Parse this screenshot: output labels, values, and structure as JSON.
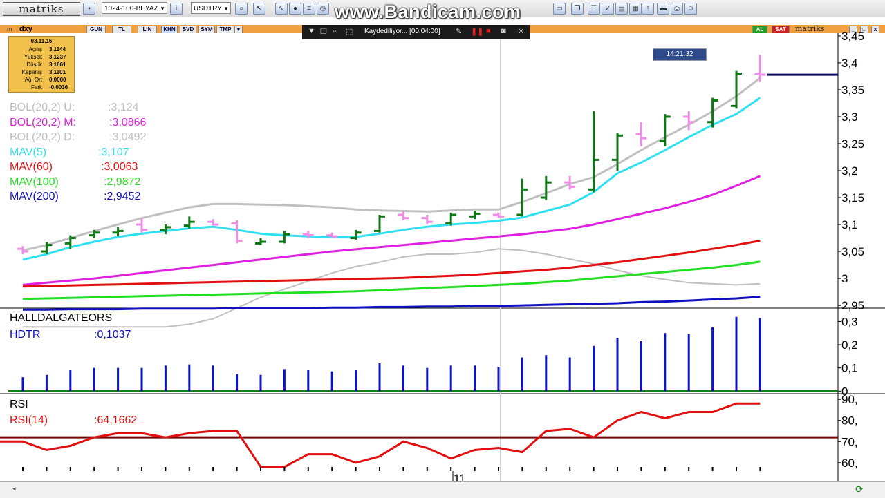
{
  "toolbar": {
    "logo": "matriks",
    "layout_combo": "1024-100-BEYAZ",
    "currency_combo": "USDTRY",
    "watermark": "www.Bandicam.com"
  },
  "subbar": {
    "symbol": "dxy",
    "periods": [
      "GUN",
      "TL",
      "LIN",
      "KHN",
      "SVD",
      "SYM",
      "TMP"
    ],
    "right_tags": [
      "AL",
      "SAT"
    ],
    "right_logo": "matriks"
  },
  "recorder": {
    "status": "Kaydediliyor... [00:04:00]"
  },
  "infobox": {
    "date": "03.11.16",
    "rows": [
      {
        "label": "Açılış",
        "value": "3,1144"
      },
      {
        "label": "Yüksek",
        "value": "3,1237"
      },
      {
        "label": "Düşük",
        "value": "3,1061"
      },
      {
        "label": "Kapanış",
        "value": "3,1101"
      },
      {
        "label": "Ağ. Ort",
        "value": "0,0000"
      },
      {
        "label": "Fark",
        "value": "-0,0036"
      }
    ]
  },
  "crosshair_time": "14:21:32",
  "x_axis_label": "11",
  "colors": {
    "bg": "#ffffff",
    "bar_up": "#0c7a12",
    "bar_down": "#f08ce8",
    "boll_band": "#c0c0c0",
    "boll_mid": "#e020e0",
    "mav5": "#30e0f0",
    "mav60": "#e01010",
    "mav100": "#20e020",
    "mav200": "#1010c0",
    "hdtr": "#0a14c8",
    "rsi": "#e01010",
    "rsi_level": "#800000",
    "last_price_line": "#0a0a60",
    "zero_line": "#108010"
  },
  "chart_data": [
    {
      "type": "ohlc",
      "title": "dxy",
      "legend": [
        {
          "name": "BOL(20,2) U:",
          "value": ":3,124",
          "color": "#c0c0c0"
        },
        {
          "name": "BOL(20,2) M:",
          "value": ":3,0866",
          "color": "#e020e0"
        },
        {
          "name": "BOL(20,2) D:",
          "value": ":3,0492",
          "color": "#c0c0c0"
        },
        {
          "name": "MAV(5)",
          "value": ":3,107",
          "color": "#30e0f0"
        },
        {
          "name": "MAV(60)",
          "value": ":3,0063",
          "color": "#e01010"
        },
        {
          "name": "MAV(100)",
          "value": ":2,9872",
          "color": "#20e020"
        },
        {
          "name": "MAV(200)",
          "value": ":2,9452",
          "color": "#1010c0"
        }
      ],
      "y_ticks": [
        "3,45",
        "3,4",
        "3,35",
        "3,3",
        "3,25",
        "3,2",
        "3,15",
        "3,1",
        "3,05",
        "3",
        "2,95"
      ],
      "ylim": [
        2.945,
        3.455
      ],
      "bars": [
        {
          "o": 3.055,
          "h": 3.06,
          "l": 3.045,
          "c": 3.05,
          "up": false
        },
        {
          "o": 3.05,
          "h": 3.068,
          "l": 3.045,
          "c": 3.062,
          "up": true
        },
        {
          "o": 3.065,
          "h": 3.08,
          "l": 3.055,
          "c": 3.075,
          "up": true
        },
        {
          "o": 3.08,
          "h": 3.09,
          "l": 3.075,
          "c": 3.085,
          "up": true
        },
        {
          "o": 3.085,
          "h": 3.095,
          "l": 3.078,
          "c": 3.088,
          "up": true
        },
        {
          "o": 3.1,
          "h": 3.112,
          "l": 3.085,
          "c": 3.09,
          "up": false
        },
        {
          "o": 3.09,
          "h": 3.1,
          "l": 3.082,
          "c": 3.095,
          "up": true
        },
        {
          "o": 3.098,
          "h": 3.115,
          "l": 3.092,
          "c": 3.105,
          "up": true
        },
        {
          "o": 3.105,
          "h": 3.11,
          "l": 3.098,
          "c": 3.1,
          "up": false
        },
        {
          "o": 3.102,
          "h": 3.108,
          "l": 3.065,
          "c": 3.07,
          "up": false
        },
        {
          "o": 3.065,
          "h": 3.075,
          "l": 3.062,
          "c": 3.068,
          "up": true
        },
        {
          "o": 3.068,
          "h": 3.088,
          "l": 3.065,
          "c": 3.082,
          "up": true
        },
        {
          "o": 3.082,
          "h": 3.088,
          "l": 3.075,
          "c": 3.08,
          "up": false
        },
        {
          "o": 3.08,
          "h": 3.085,
          "l": 3.075,
          "c": 3.078,
          "up": false
        },
        {
          "o": 3.075,
          "h": 3.09,
          "l": 3.072,
          "c": 3.085,
          "up": true
        },
        {
          "o": 3.088,
          "h": 3.118,
          "l": 3.085,
          "c": 3.115,
          "up": true
        },
        {
          "o": 3.118,
          "h": 3.125,
          "l": 3.108,
          "c": 3.112,
          "up": false
        },
        {
          "o": 3.112,
          "h": 3.118,
          "l": 3.1,
          "c": 3.105,
          "up": false
        },
        {
          "o": 3.102,
          "h": 3.122,
          "l": 3.098,
          "c": 3.118,
          "up": true
        },
        {
          "o": 3.115,
          "h": 3.125,
          "l": 3.11,
          "c": 3.12,
          "up": true
        },
        {
          "o": 3.118,
          "h": 3.122,
          "l": 3.112,
          "c": 3.115,
          "up": false
        },
        {
          "o": 3.118,
          "h": 3.185,
          "l": 3.115,
          "c": 3.165,
          "up": true
        },
        {
          "o": 3.15,
          "h": 3.19,
          "l": 3.145,
          "c": 3.178,
          "up": true
        },
        {
          "o": 3.178,
          "h": 3.19,
          "l": 3.165,
          "c": 3.17,
          "up": false
        },
        {
          "o": 3.165,
          "h": 3.31,
          "l": 3.16,
          "c": 3.22,
          "up": true
        },
        {
          "o": 3.22,
          "h": 3.27,
          "l": 3.2,
          "c": 3.265,
          "up": true
        },
        {
          "o": 3.268,
          "h": 3.29,
          "l": 3.245,
          "c": 3.26,
          "up": false
        },
        {
          "o": 3.255,
          "h": 3.305,
          "l": 3.245,
          "c": 3.3,
          "up": true
        },
        {
          "o": 3.3,
          "h": 3.31,
          "l": 3.275,
          "c": 3.29,
          "up": false
        },
        {
          "o": 3.29,
          "h": 3.335,
          "l": 3.28,
          "c": 3.33,
          "up": true
        },
        {
          "o": 3.32,
          "h": 3.385,
          "l": 3.315,
          "c": 3.38,
          "up": true
        },
        {
          "o": 3.38,
          "h": 3.415,
          "l": 3.365,
          "c": 3.378,
          "up": false
        }
      ],
      "last_price": 3.378,
      "series": [
        {
          "name": "BOL(20,2) U",
          "values": [
            3.052,
            3.062,
            3.075,
            3.088,
            3.1,
            3.112,
            3.122,
            3.132,
            3.138,
            3.138,
            3.137,
            3.136,
            3.134,
            3.132,
            3.128,
            3.126,
            3.125,
            3.124,
            3.126,
            3.128,
            3.128,
            3.142,
            3.158,
            3.175,
            3.188,
            3.212,
            3.238,
            3.262,
            3.285,
            3.31,
            3.338,
            3.372
          ]
        },
        {
          "name": "BOL(20,2) M",
          "values": [
            2.988,
            2.992,
            2.996,
            3.0,
            3.005,
            3.01,
            3.015,
            3.02,
            3.025,
            3.03,
            3.035,
            3.04,
            3.045,
            3.05,
            3.054,
            3.058,
            3.062,
            3.066,
            3.07,
            3.074,
            3.078,
            3.082,
            3.087,
            3.092,
            3.1,
            3.11,
            3.12,
            3.13,
            3.142,
            3.155,
            3.172,
            3.19
          ]
        },
        {
          "name": "BOL(20,2) D",
          "values": [
            2.91,
            2.91,
            2.91,
            2.91,
            2.91,
            2.91,
            2.91,
            2.915,
            2.925,
            2.945,
            2.965,
            2.98,
            2.995,
            3.01,
            3.022,
            3.03,
            3.04,
            3.045,
            3.045,
            3.048,
            3.055,
            3.052,
            3.045,
            3.036,
            3.027,
            3.015,
            3.005,
            2.998,
            2.992,
            2.99,
            2.988,
            2.99
          ]
        },
        {
          "name": "MAV(5)",
          "values": [
            3.035,
            3.045,
            3.058,
            3.068,
            3.077,
            3.083,
            3.088,
            3.093,
            3.096,
            3.09,
            3.083,
            3.08,
            3.078,
            3.077,
            3.077,
            3.083,
            3.09,
            3.096,
            3.1,
            3.103,
            3.107,
            3.113,
            3.125,
            3.137,
            3.16,
            3.195,
            3.215,
            3.238,
            3.262,
            3.285,
            3.305,
            3.335
          ]
        },
        {
          "name": "MAV(60)",
          "values": [
            2.985,
            2.986,
            2.987,
            2.988,
            2.989,
            2.99,
            2.991,
            2.992,
            2.993,
            2.994,
            2.995,
            2.996,
            2.997,
            2.998,
            2.999,
            3.0,
            3.001,
            3.003,
            3.005,
            3.007,
            3.01,
            3.013,
            3.016,
            3.02,
            3.025,
            3.03,
            3.036,
            3.042,
            3.048,
            3.055,
            3.062,
            3.07
          ]
        },
        {
          "name": "MAV(100)",
          "values": [
            2.962,
            2.963,
            2.964,
            2.965,
            2.966,
            2.967,
            2.968,
            2.969,
            2.97,
            2.971,
            2.972,
            2.973,
            2.974,
            2.975,
            2.976,
            2.978,
            2.98,
            2.982,
            2.984,
            2.986,
            2.988,
            2.99,
            2.993,
            2.996,
            3.0,
            3.004,
            3.008,
            3.012,
            3.016,
            3.02,
            3.025,
            3.031
          ]
        },
        {
          "name": "MAV(200)",
          "values": [
            2.942,
            2.942,
            2.943,
            2.943,
            2.943,
            2.944,
            2.944,
            2.944,
            2.944,
            2.945,
            2.945,
            2.945,
            2.945,
            2.946,
            2.946,
            2.947,
            2.947,
            2.948,
            2.948,
            2.949,
            2.949,
            2.95,
            2.951,
            2.952,
            2.953,
            2.954,
            2.956,
            2.957,
            2.959,
            2.961,
            2.963,
            2.966
          ]
        }
      ]
    },
    {
      "type": "bar",
      "title": "HALLDALGATEORS",
      "legend": [
        {
          "name": "HDTR",
          "value": ":0,1037",
          "color": "#0a14c8"
        }
      ],
      "y_ticks": [
        "0,3",
        "0,2",
        "0,1",
        "0"
      ],
      "ylim": [
        -0.005,
        0.34
      ],
      "values": [
        0.06,
        0.07,
        0.09,
        0.1,
        0.1,
        0.1,
        0.11,
        0.115,
        0.11,
        0.075,
        0.07,
        0.095,
        0.09,
        0.085,
        0.09,
        0.12,
        0.11,
        0.1,
        0.11,
        0.11,
        0.105,
        0.145,
        0.155,
        0.145,
        0.195,
        0.23,
        0.215,
        0.25,
        0.245,
        0.275,
        0.32,
        0.315
      ]
    },
    {
      "type": "line",
      "title": "RSI",
      "legend": [
        {
          "name": "RSI(14)",
          "value": ":64,1662",
          "color": "#e01010"
        }
      ],
      "y_ticks": [
        "90",
        "80",
        "70",
        "60"
      ],
      "ylim": [
        58,
        92
      ],
      "level": 72,
      "values": [
        70,
        66,
        68,
        72,
        74,
        74,
        72,
        74,
        75,
        75,
        58,
        58,
        64,
        64,
        60,
        63,
        70,
        67,
        62,
        66,
        67,
        65,
        75,
        76,
        72,
        80,
        84,
        81,
        84,
        84,
        88,
        88
      ]
    }
  ]
}
